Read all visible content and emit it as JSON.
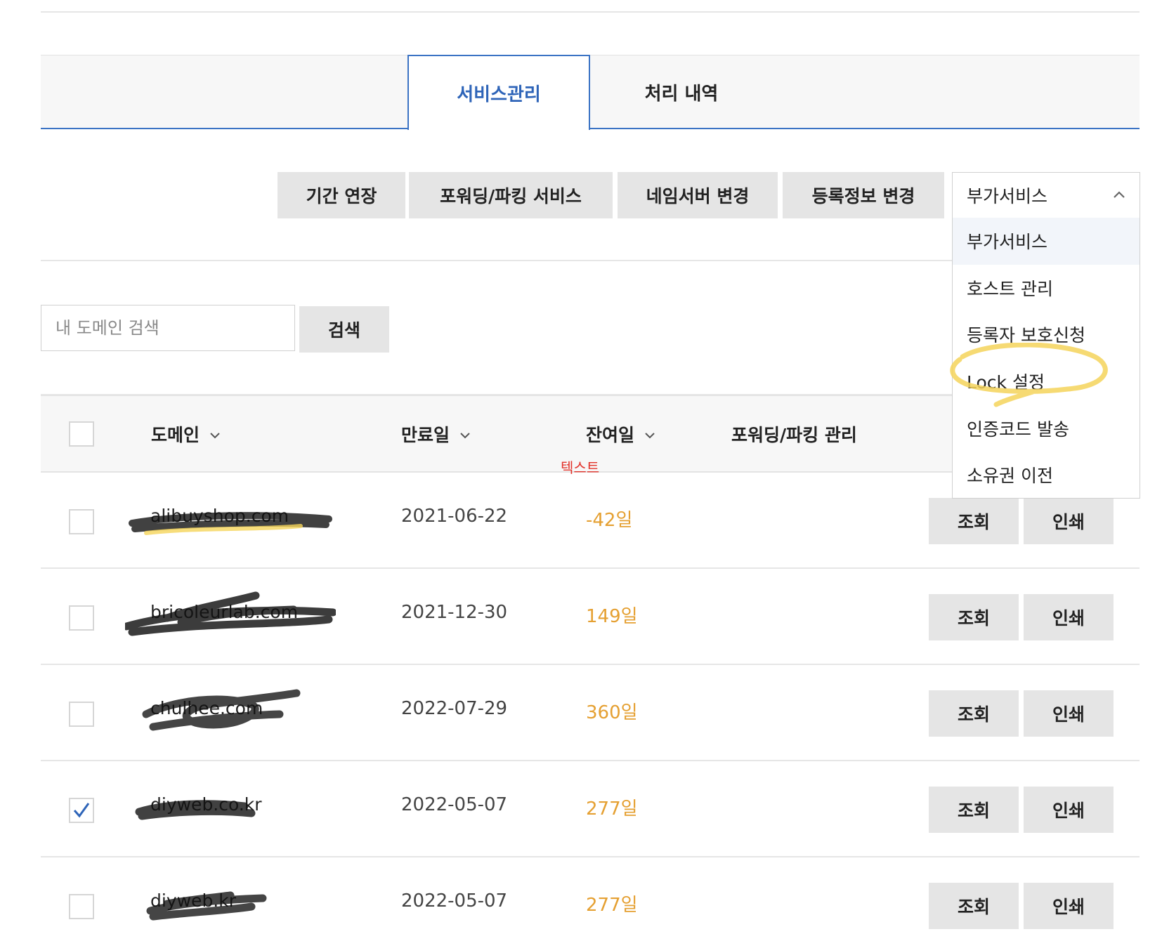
{
  "tabs": [
    {
      "label": "서비스관리",
      "active": true
    },
    {
      "label": "처리 내역",
      "active": false
    }
  ],
  "actions": {
    "extend": "기간 연장",
    "forwarding": "포워딩/파킹 서비스",
    "nameserver": "네임서버 변경",
    "registration": "등록정보 변경"
  },
  "addon": {
    "selected": "부가서비스",
    "options": [
      "부가서비스",
      "호스트 관리",
      "등록자 보호신청",
      "Lock 설정",
      "인증코드 발송",
      "소유권 이전"
    ]
  },
  "search": {
    "placeholder": "내 도메인 검색",
    "button": "검색"
  },
  "table": {
    "headers": {
      "domain": "도메인",
      "expiry": "만료일",
      "remaining": "잔여일",
      "forwarding": "포워딩/파킹 관리"
    },
    "note": "텍스트",
    "rows": [
      {
        "domain": "alibuyshop.com",
        "expiry": "2021-06-22",
        "remaining": "-42일",
        "checked": false,
        "view": "조회",
        "print": "인쇄"
      },
      {
        "domain": "bricoleurlab.com",
        "expiry": "2021-12-30",
        "remaining": "149일",
        "checked": false,
        "view": "조회",
        "print": "인쇄"
      },
      {
        "domain": "chulhee.com",
        "expiry": "2022-07-29",
        "remaining": "360일",
        "checked": false,
        "view": "조회",
        "print": "인쇄"
      },
      {
        "domain": "diyweb.co.kr",
        "expiry": "2022-05-07",
        "remaining": "277일",
        "checked": true,
        "view": "조회",
        "print": "인쇄"
      },
      {
        "domain": "diyweb.kr",
        "expiry": "2022-05-07",
        "remaining": "277일",
        "checked": false,
        "view": "조회",
        "print": "인쇄"
      }
    ]
  },
  "colors": {
    "accent": "#3b73c4",
    "remaining": "#e5a032",
    "note": "#e2322a",
    "highlight": "#f5d45a"
  }
}
